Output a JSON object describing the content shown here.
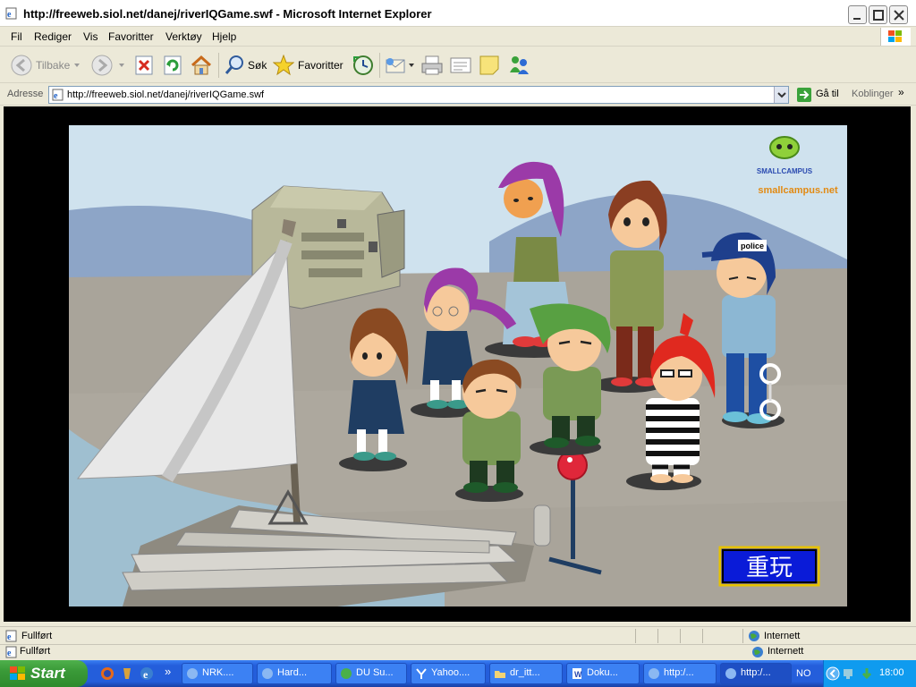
{
  "window": {
    "title": "http://freeweb.siol.net/danej/riverIQGame.swf - Microsoft Internet Explorer"
  },
  "menu": [
    "Fil",
    "Rediger",
    "Vis",
    "Favoritter",
    "Verktøy",
    "Hjelp"
  ],
  "toolbar": {
    "back_label": "Tilbake",
    "search_label": "Søk",
    "favorites_label": "Favoritter"
  },
  "address": {
    "label": "Adresse",
    "url": "http://freeweb.siol.net/danej/riverIQGame.swf",
    "go_label": "Gå til",
    "links_label": "Koblinger"
  },
  "game": {
    "logo_text": "smallcampus.net",
    "logo_name": "SMALLCAMPUS",
    "police_cap": "police",
    "replay_label": "重玩",
    "colors": {
      "sky": "#cfe2ee",
      "river": "#9fbfd0",
      "ground": "#a9a49a",
      "replay_bg": "#0a1bd8",
      "replay_border": "#e6c200"
    }
  },
  "status": {
    "left_text": "Fullført",
    "zone_text": "Internett",
    "left_text_2": "Fullført",
    "zone_text_2": "Internett"
  },
  "taskbar": {
    "start_label": "Start",
    "tasks": [
      "NRK....",
      "Hard...",
      "DU Su...",
      "Yahoo....",
      "dr_itt...",
      "Doku...",
      "http:/...",
      "http:/..."
    ],
    "lang": "NO",
    "clock": "18:00"
  }
}
